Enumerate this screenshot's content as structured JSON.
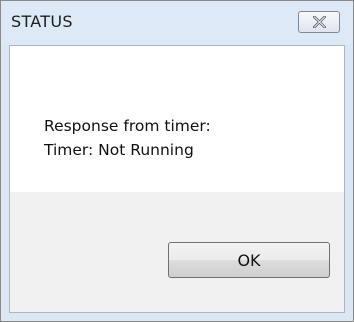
{
  "dialog": {
    "title": "STATUS",
    "close_icon": "close-icon",
    "message_lines": [
      "Response from timer:",
      "Timer: Not Running"
    ],
    "ok_label": "OK"
  }
}
